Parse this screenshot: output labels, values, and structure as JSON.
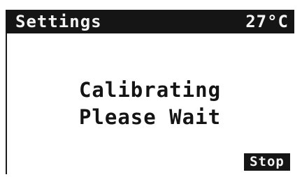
{
  "header": {
    "title": "Settings",
    "temperature": "27°C"
  },
  "main": {
    "message_line1": "Calibrating",
    "message_line2": "Please Wait"
  },
  "footer": {
    "stop_label": "Stop"
  },
  "colors": {
    "background": "#ffffff",
    "foreground": "#151515",
    "inverse_text": "#f4f4f4"
  }
}
